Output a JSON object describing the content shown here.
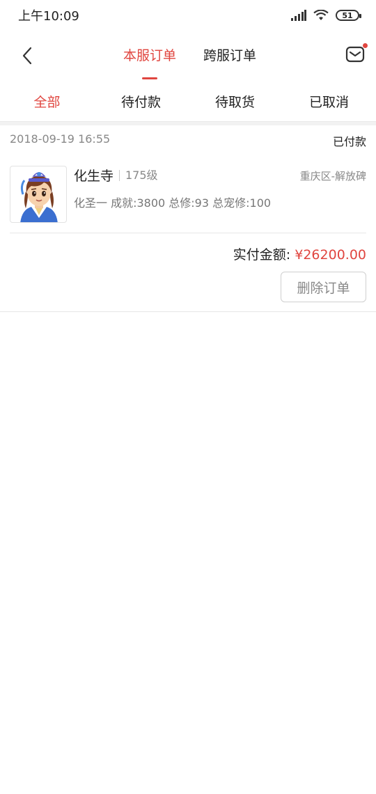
{
  "status_bar": {
    "time": "上午10:09",
    "battery": "51"
  },
  "header": {
    "tabs": [
      {
        "label": "本服订单",
        "active": true
      },
      {
        "label": "跨服订单",
        "active": false
      }
    ]
  },
  "sub_tabs": [
    {
      "label": "全部",
      "active": true
    },
    {
      "label": "待付款",
      "active": false
    },
    {
      "label": "待取货",
      "active": false
    },
    {
      "label": "已取消",
      "active": false
    }
  ],
  "order": {
    "date": "2018-09-19 16:55",
    "status": "已付款",
    "item": {
      "name": "化生寺",
      "level": "175级",
      "server": "重庆区-解放碑",
      "desc": "化圣一 成就:3800 总修:93 总宠修:100"
    },
    "total_label": "实付金额:",
    "total_amount": "¥26200.00",
    "delete_label": "删除订单"
  },
  "colors": {
    "accent": "#e0453f"
  }
}
